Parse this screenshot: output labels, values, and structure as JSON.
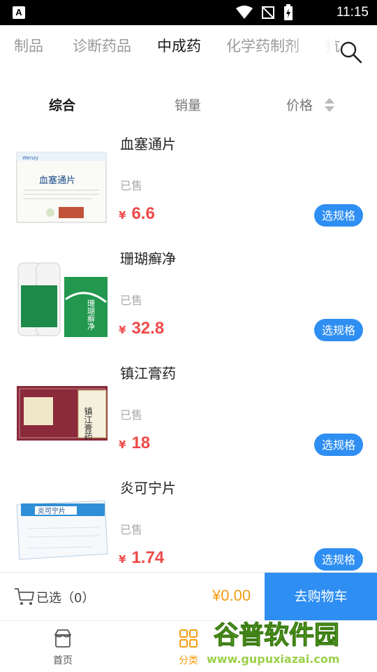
{
  "status_bar": {
    "time": "11:15",
    "left_icon_letter": "A"
  },
  "category_tabs": {
    "items": [
      "制品",
      "诊断药品",
      "中成药",
      "化学药制剂",
      "抗"
    ],
    "active_index": 2
  },
  "sort_bar": {
    "comprehensive": "综合",
    "sales": "销量",
    "price": "价格"
  },
  "products": [
    {
      "name": "血塞通片",
      "sold_label": "已售",
      "currency": "¥",
      "price": "6.6",
      "spec_button": "选规格",
      "image_label": "血塞通片"
    },
    {
      "name": "珊瑚癣净",
      "sold_label": "已售",
      "currency": "¥",
      "price": "32.8",
      "spec_button": "选规格",
      "image_label": "珊瑚癣净"
    },
    {
      "name": "镇江膏药",
      "sold_label": "已售",
      "currency": "¥",
      "price": "18",
      "spec_button": "选规格",
      "image_label": "镇江膏药"
    },
    {
      "name": "炎可宁片",
      "sold_label": "已售",
      "currency": "¥",
      "price": "1.74",
      "spec_button": "选规格",
      "image_label": "炎可宁片"
    }
  ],
  "cart_bar": {
    "selected_label": "已选（0）",
    "total": "¥0.00",
    "go_cart": "去购物车"
  },
  "bottom_nav": [
    {
      "label": "首页",
      "icon": "home-icon",
      "active": false
    },
    {
      "label": "分类",
      "icon": "category-icon",
      "active": true
    }
  ],
  "watermark": {
    "title": "谷普软件园",
    "url": "www.gupuxiazai.com"
  },
  "colors": {
    "accent": "#2e8ef2",
    "price": "#ef4a4a",
    "total": "#f39c12"
  }
}
